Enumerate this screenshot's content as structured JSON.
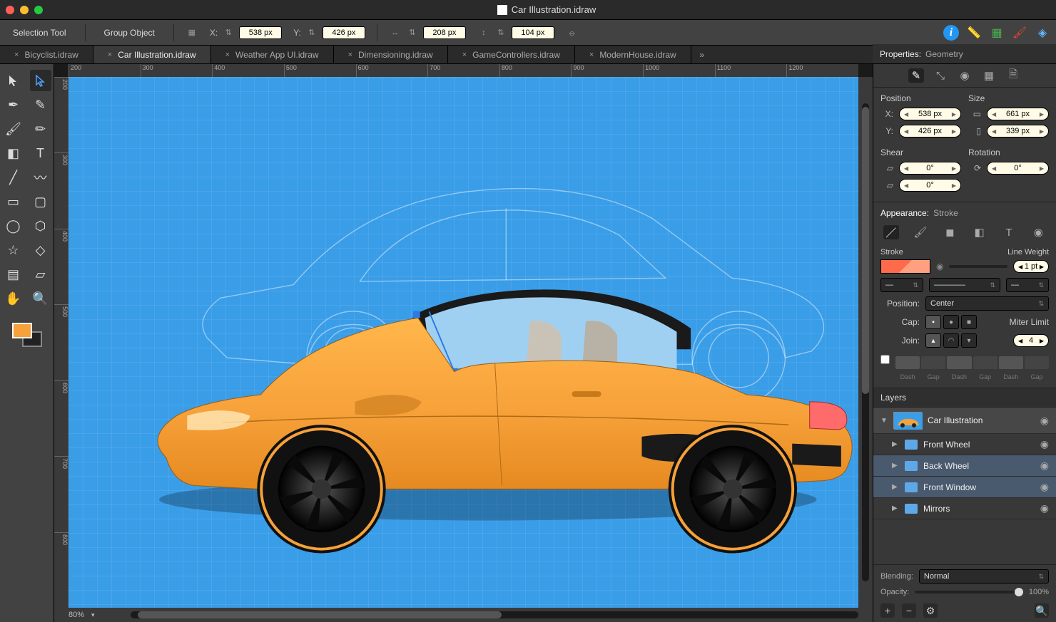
{
  "title": "Car Illustration.idraw",
  "options": {
    "tool": "Selection Tool",
    "group": "Group Object",
    "x_label": "X:",
    "x_value": "538 px",
    "y_label": "Y:",
    "y_value": "426 px",
    "w_value": "208 px",
    "h_value": "104 px"
  },
  "tabs": [
    {
      "label": "Bicyclist.idraw",
      "active": false
    },
    {
      "label": "Car Illustration.idraw",
      "active": true
    },
    {
      "label": "Weather App UI.idraw",
      "active": false
    },
    {
      "label": "Dimensioning.idraw",
      "active": false
    },
    {
      "label": "GameControllers.idraw",
      "active": false
    },
    {
      "label": "ModernHouse.idraw",
      "active": false
    }
  ],
  "ruler_h": [
    "200",
    "300",
    "400",
    "500",
    "600",
    "700",
    "800",
    "900",
    "1000",
    "1100",
    "1200"
  ],
  "ruler_v": [
    "200",
    "300",
    "400",
    "500",
    "600",
    "700",
    "800"
  ],
  "zoom": "80%",
  "properties": {
    "header_label": "Properties:",
    "header_sub": "Geometry",
    "position_label": "Position",
    "size_label": "Size",
    "x_label": "X:",
    "x_value": "538 px",
    "y_label": "Y:",
    "y_value": "426 px",
    "w_value": "661 px",
    "h_value": "339 px",
    "shear_label": "Shear",
    "rotation_label": "Rotation",
    "shear_h": "0°",
    "shear_v": "0°",
    "rotation_value": "0°"
  },
  "appearance": {
    "header_label": "Appearance:",
    "header_sub": "Stroke",
    "stroke_label": "Stroke",
    "lineweight_label": "Line Weight",
    "lineweight_value": "1 pt",
    "position_label": "Position:",
    "position_value": "Center",
    "cap_label": "Cap:",
    "join_label": "Join:",
    "miterlimit_label": "Miter Limit",
    "miterlimit_value": "4",
    "dash_labels": [
      "Dash",
      "Gap",
      "Dash",
      "Gap",
      "Dash",
      "Gap"
    ]
  },
  "layers": {
    "header": "Layers",
    "master": "Car Illustration",
    "items": [
      {
        "name": "Front Wheel",
        "selected": false
      },
      {
        "name": "Back Wheel",
        "selected": true
      },
      {
        "name": "Front Window",
        "selected": true
      },
      {
        "name": "Mirrors",
        "selected": false
      }
    ],
    "blending_label": "Blending:",
    "blending_value": "Normal",
    "opacity_label": "Opacity:",
    "opacity_value": "100%"
  }
}
